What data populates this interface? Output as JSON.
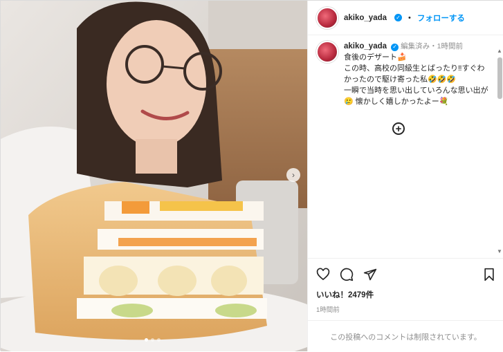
{
  "post": {
    "image_alt": "ケーキを前に自撮りする女性",
    "carousel_dots": 3,
    "active_dot": 0
  },
  "header": {
    "username": "akiko_yada",
    "separator": "•",
    "follow_label": "フォローする",
    "more_label": "…"
  },
  "caption": {
    "username": "akiko_yada",
    "meta": "編集済み・1時間前",
    "lines": [
      "食後のデザート🍰",
      "この時、高校の同級生とばったり‼すぐわかったので駆け寄った私🤣🤣🤣",
      "一瞬で当時を思い出していろんな思い出が🥲 懐かしく嬉しかったよー💐"
    ]
  },
  "engagement": {
    "likes": "いいね！2479件",
    "time": "1時間前"
  },
  "comments": {
    "disabled_text": "この投稿へのコメントは制限されています。"
  },
  "icons": {
    "verified": "verified-badge-icon",
    "add": "plus-circle-icon",
    "like": "heart-icon",
    "comment": "comment-icon",
    "share": "share-icon",
    "save": "bookmark-icon",
    "next": "chevron-right-icon"
  },
  "colors": {
    "accent": "#0095f6",
    "text": "#262626",
    "muted": "#8e8e8e"
  }
}
